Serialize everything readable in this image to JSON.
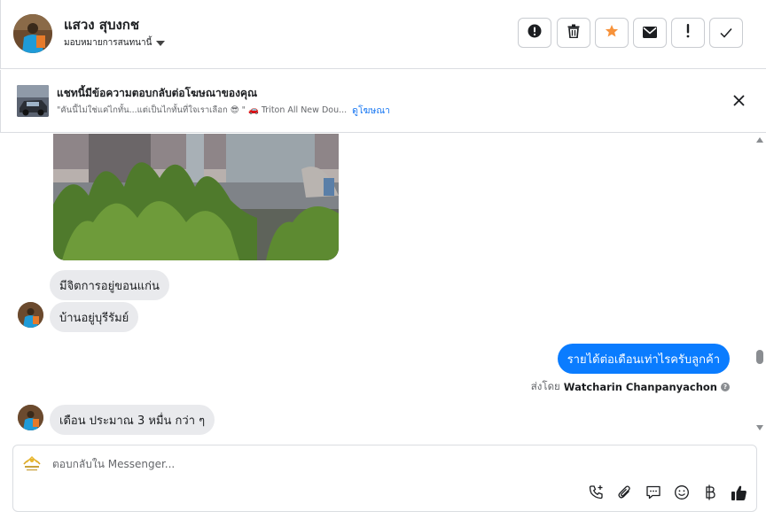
{
  "header": {
    "contact_name": "แสวง สุบงกช",
    "assign_label": "มอบหมายการสนทนานี้"
  },
  "toolbar": {
    "icons": [
      "alert-circle-icon",
      "trash-icon",
      "star-icon",
      "envelope-icon",
      "exclamation-icon",
      "check-icon"
    ],
    "star_color": "#f7923a"
  },
  "ad": {
    "title": "แชทนี้มีข้อความตอบกลับต่อโฆษณาของคุณ",
    "preview": "\"คันนี้ไม่ใช่แค่ไกทั้น...แต่เป็นไกทั้นที่ใจเราเลือก 😎 \" 🚗 Triton All New Dou...",
    "link": "ดูโฆษณา"
  },
  "messages": {
    "in_1": "มีจิตการอยู่ขอนแก่น",
    "in_2": "บ้านอยู่บุรีรัมย์",
    "out_1": "รายได้ต่อเดือนเท่าไรครับลูกค้า",
    "sent_by_label": "ส่งโดย",
    "sent_by_name": "Watcharin Chanpanyachon",
    "in_3": "เดือน ประมาณ 3 หมื่น กว่า ๆ"
  },
  "composer": {
    "placeholder": "ตอบกลับใน Messenger...",
    "icons": [
      "phone-plus-icon",
      "paperclip-icon",
      "chat-bubble-icon",
      "smiley-icon",
      "baht-icon",
      "thumbs-up-icon"
    ]
  },
  "colors": {
    "outgoing_bubble": "#0a7cff",
    "incoming_bubble": "#e9eaed",
    "link": "#1877f2"
  }
}
